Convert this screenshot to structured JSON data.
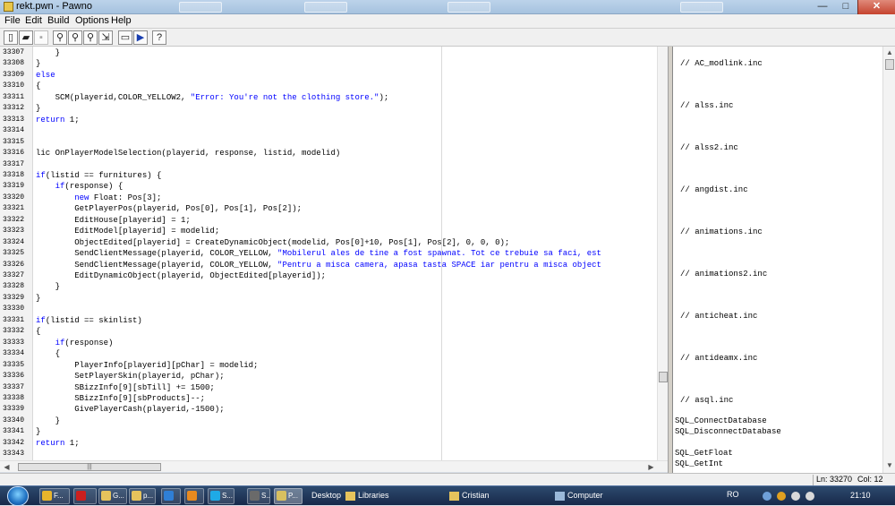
{
  "window": {
    "title": "rekt.pwn - Pawno",
    "min_glyph": "—",
    "max_glyph": "□",
    "close_glyph": "✕"
  },
  "menu": {
    "file": "File",
    "edit": "Edit",
    "build": "Build",
    "options": "Options",
    "help": "Help"
  },
  "toolbar": {
    "icons": [
      "new-icon",
      "open-icon",
      "save-icon",
      "find-icon",
      "find-next-icon",
      "replace-icon",
      "goto-icon",
      "compile-options-icon",
      "compile-icon",
      "help-icon"
    ],
    "glyphs": {
      "new": "▯",
      "open": "▰",
      "save": "▪",
      "find": "⚲",
      "find_next": "⚲",
      "replace": "⚲",
      "goto": "⇲",
      "compile_options": "▭",
      "compile": "▶",
      "help": "?"
    }
  },
  "editor": {
    "line_numbers": [
      "33307",
      "33308",
      "33309",
      "33310",
      "33311",
      "33312",
      "33313",
      "33314",
      "33315",
      "33316",
      "33317",
      "33318",
      "33319",
      "33320",
      "33321",
      "33322",
      "33323",
      "33324",
      "33325",
      "33326",
      "33327",
      "33328",
      "33329",
      "33330",
      "33331",
      "33332",
      "33333",
      "33334",
      "33335",
      "33336",
      "33337",
      "33338",
      "33339",
      "33340",
      "33341",
      "33342",
      "33343"
    ],
    "lines": [
      "    }",
      "}",
      "else",
      "{",
      "    SCM(playerid,COLOR_YELLOW2, \"Error: You're not the clothing store.\");",
      "}",
      "return 1;",
      "",
      "",
      "lic OnPlayerModelSelection(playerid, response, listid, modelid)",
      "",
      "if(listid == furnitures) {",
      "    if(response) {",
      "        new Float: Pos[3];",
      "        GetPlayerPos(playerid, Pos[0], Pos[1], Pos[2]);",
      "        EditHouse[playerid] = 1;",
      "        EditModel[playerid] = modelid;",
      "        ObjectEdited[playerid] = CreateDynamicObject(modelid, Pos[0]+10, Pos[1], Pos[2], 0, 0, 0);",
      "        SendClientMessage(playerid, COLOR_YELLOW, \"Mobilerul ales de tine a fost spawnat. Tot ce trebuie sa faci, est",
      "        SendClientMessage(playerid, COLOR_YELLOW, \"Pentru a misca camera, apasa tasta SPACE iar pentru a misca object",
      "        EditDynamicObject(playerid, ObjectEdited[playerid]);",
      "    }",
      "}",
      "",
      "if(listid == skinlist)",
      "{",
      "    if(response)",
      "    {",
      "        PlayerInfo[playerid][pChar] = modelid;",
      "        SetPlayerSkin(playerid, pChar);",
      "        SBizzInfo[9][sbTill] += 1500;",
      "        SBizzInfo[9][sbProducts]--;",
      "        GivePlayerCash(playerid,-1500);",
      "    }",
      "}",
      "return 1;",
      ""
    ]
  },
  "function_list": {
    "items": [
      "// AC_modlink.inc",
      "// alss.inc",
      "// alss2.inc",
      "// angdist.inc",
      "// animations.inc",
      "// animations2.inc",
      "// anticheat.inc",
      "// antideamx.inc",
      "// asql.inc",
      "SQL_ConnectDatabase",
      "SQL_DisconnectDatabase",
      "SQL_GetFloat",
      "SQL_GetInt"
    ]
  },
  "status": {
    "line": "Ln: 33270",
    "col": "Col: 12"
  },
  "taskbar": {
    "buttons": [
      {
        "label": "F...",
        "icon": "chrome-icon"
      },
      {
        "label": "",
        "icon": "opera-icon"
      },
      {
        "label": "G...",
        "icon": "folder-icon"
      },
      {
        "label": "p...",
        "icon": "folder-icon"
      },
      {
        "label": "",
        "icon": "ie-icon"
      },
      {
        "label": "",
        "icon": "media-icon"
      },
      {
        "label": "S...",
        "icon": "skype-icon"
      },
      {
        "label": "S...",
        "icon": "samp-icon"
      },
      {
        "label": "P...",
        "icon": "pawno-icon"
      }
    ],
    "toolbars": {
      "desktop": "Desktop",
      "libraries": "Libraries",
      "user": "Cristian",
      "computer": "Computer"
    },
    "tray": {
      "language": "RO",
      "clock": "21:10"
    }
  },
  "colors": {
    "keyword": "#0000ff",
    "string": "#0000ff",
    "taskbar": "#1e355a"
  }
}
